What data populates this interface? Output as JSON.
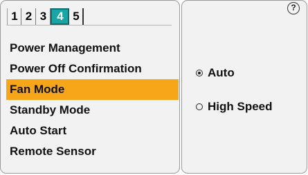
{
  "tabs": [
    {
      "label": "1",
      "active": false
    },
    {
      "label": "2",
      "active": false
    },
    {
      "label": "3",
      "active": false
    },
    {
      "label": "4",
      "active": true
    },
    {
      "label": "5",
      "active": false
    }
  ],
  "menu": {
    "items": [
      {
        "label": "Power Management"
      },
      {
        "label": "Power Off Confirmation"
      },
      {
        "label": "Fan Mode",
        "selected": true
      },
      {
        "label": "Standby Mode"
      },
      {
        "label": "Auto Start"
      },
      {
        "label": "Remote Sensor"
      }
    ]
  },
  "help": {
    "icon": "help-icon",
    "label": "?"
  },
  "options": [
    {
      "label": "Auto",
      "checked": true
    },
    {
      "label": "High Speed",
      "checked": false
    }
  ],
  "colors": {
    "active_tab": "#19a5a5",
    "selected_item": "#f7a61a",
    "panel_bg": "#f2f2f2"
  }
}
